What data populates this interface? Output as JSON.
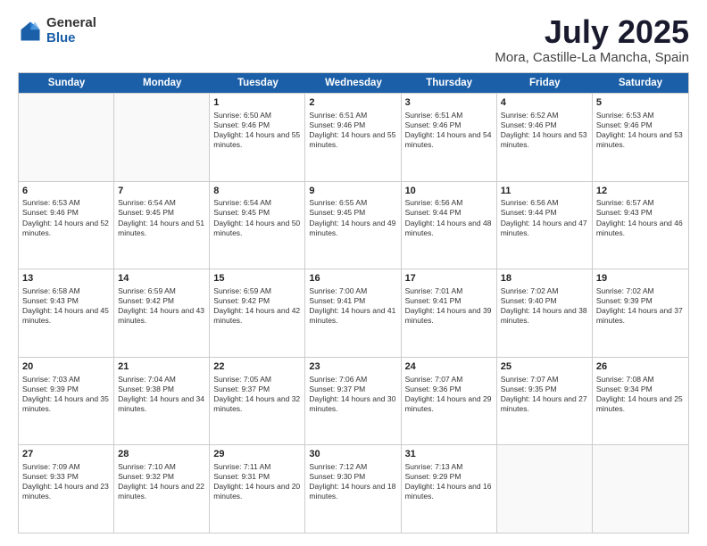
{
  "logo": {
    "general": "General",
    "blue": "Blue"
  },
  "title": {
    "month": "July 2025",
    "location": "Mora, Castille-La Mancha, Spain"
  },
  "header_days": [
    "Sunday",
    "Monday",
    "Tuesday",
    "Wednesday",
    "Thursday",
    "Friday",
    "Saturday"
  ],
  "weeks": [
    [
      {
        "day": "",
        "info": ""
      },
      {
        "day": "",
        "info": ""
      },
      {
        "day": "1",
        "info": "Sunrise: 6:50 AM\nSunset: 9:46 PM\nDaylight: 14 hours and 55 minutes."
      },
      {
        "day": "2",
        "info": "Sunrise: 6:51 AM\nSunset: 9:46 PM\nDaylight: 14 hours and 55 minutes."
      },
      {
        "day": "3",
        "info": "Sunrise: 6:51 AM\nSunset: 9:46 PM\nDaylight: 14 hours and 54 minutes."
      },
      {
        "day": "4",
        "info": "Sunrise: 6:52 AM\nSunset: 9:46 PM\nDaylight: 14 hours and 53 minutes."
      },
      {
        "day": "5",
        "info": "Sunrise: 6:53 AM\nSunset: 9:46 PM\nDaylight: 14 hours and 53 minutes."
      }
    ],
    [
      {
        "day": "6",
        "info": "Sunrise: 6:53 AM\nSunset: 9:46 PM\nDaylight: 14 hours and 52 minutes."
      },
      {
        "day": "7",
        "info": "Sunrise: 6:54 AM\nSunset: 9:45 PM\nDaylight: 14 hours and 51 minutes."
      },
      {
        "day": "8",
        "info": "Sunrise: 6:54 AM\nSunset: 9:45 PM\nDaylight: 14 hours and 50 minutes."
      },
      {
        "day": "9",
        "info": "Sunrise: 6:55 AM\nSunset: 9:45 PM\nDaylight: 14 hours and 49 minutes."
      },
      {
        "day": "10",
        "info": "Sunrise: 6:56 AM\nSunset: 9:44 PM\nDaylight: 14 hours and 48 minutes."
      },
      {
        "day": "11",
        "info": "Sunrise: 6:56 AM\nSunset: 9:44 PM\nDaylight: 14 hours and 47 minutes."
      },
      {
        "day": "12",
        "info": "Sunrise: 6:57 AM\nSunset: 9:43 PM\nDaylight: 14 hours and 46 minutes."
      }
    ],
    [
      {
        "day": "13",
        "info": "Sunrise: 6:58 AM\nSunset: 9:43 PM\nDaylight: 14 hours and 45 minutes."
      },
      {
        "day": "14",
        "info": "Sunrise: 6:59 AM\nSunset: 9:42 PM\nDaylight: 14 hours and 43 minutes."
      },
      {
        "day": "15",
        "info": "Sunrise: 6:59 AM\nSunset: 9:42 PM\nDaylight: 14 hours and 42 minutes."
      },
      {
        "day": "16",
        "info": "Sunrise: 7:00 AM\nSunset: 9:41 PM\nDaylight: 14 hours and 41 minutes."
      },
      {
        "day": "17",
        "info": "Sunrise: 7:01 AM\nSunset: 9:41 PM\nDaylight: 14 hours and 39 minutes."
      },
      {
        "day": "18",
        "info": "Sunrise: 7:02 AM\nSunset: 9:40 PM\nDaylight: 14 hours and 38 minutes."
      },
      {
        "day": "19",
        "info": "Sunrise: 7:02 AM\nSunset: 9:39 PM\nDaylight: 14 hours and 37 minutes."
      }
    ],
    [
      {
        "day": "20",
        "info": "Sunrise: 7:03 AM\nSunset: 9:39 PM\nDaylight: 14 hours and 35 minutes."
      },
      {
        "day": "21",
        "info": "Sunrise: 7:04 AM\nSunset: 9:38 PM\nDaylight: 14 hours and 34 minutes."
      },
      {
        "day": "22",
        "info": "Sunrise: 7:05 AM\nSunset: 9:37 PM\nDaylight: 14 hours and 32 minutes."
      },
      {
        "day": "23",
        "info": "Sunrise: 7:06 AM\nSunset: 9:37 PM\nDaylight: 14 hours and 30 minutes."
      },
      {
        "day": "24",
        "info": "Sunrise: 7:07 AM\nSunset: 9:36 PM\nDaylight: 14 hours and 29 minutes."
      },
      {
        "day": "25",
        "info": "Sunrise: 7:07 AM\nSunset: 9:35 PM\nDaylight: 14 hours and 27 minutes."
      },
      {
        "day": "26",
        "info": "Sunrise: 7:08 AM\nSunset: 9:34 PM\nDaylight: 14 hours and 25 minutes."
      }
    ],
    [
      {
        "day": "27",
        "info": "Sunrise: 7:09 AM\nSunset: 9:33 PM\nDaylight: 14 hours and 23 minutes."
      },
      {
        "day": "28",
        "info": "Sunrise: 7:10 AM\nSunset: 9:32 PM\nDaylight: 14 hours and 22 minutes."
      },
      {
        "day": "29",
        "info": "Sunrise: 7:11 AM\nSunset: 9:31 PM\nDaylight: 14 hours and 20 minutes."
      },
      {
        "day": "30",
        "info": "Sunrise: 7:12 AM\nSunset: 9:30 PM\nDaylight: 14 hours and 18 minutes."
      },
      {
        "day": "31",
        "info": "Sunrise: 7:13 AM\nSunset: 9:29 PM\nDaylight: 14 hours and 16 minutes."
      },
      {
        "day": "",
        "info": ""
      },
      {
        "day": "",
        "info": ""
      }
    ]
  ]
}
